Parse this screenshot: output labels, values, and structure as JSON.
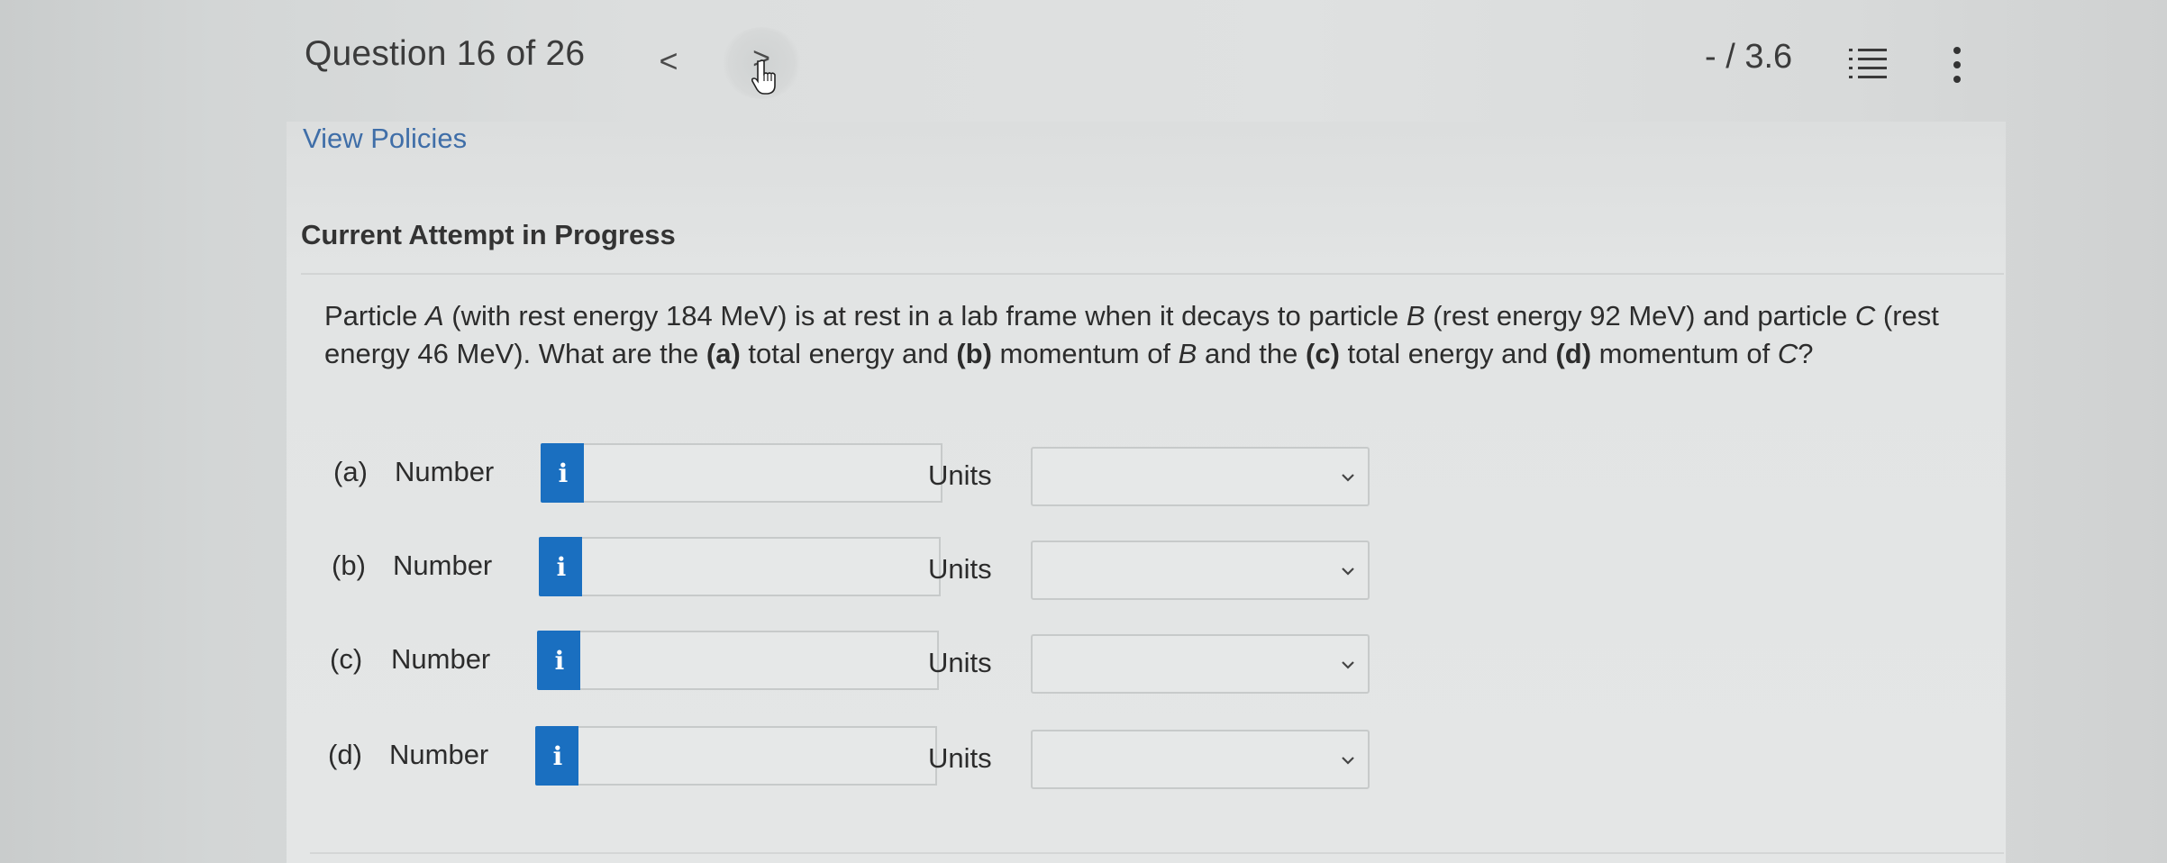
{
  "header": {
    "question_counter": "Question 16 of 26",
    "prev_glyph": "<",
    "next_glyph": ">",
    "score": "- / 3.6"
  },
  "view_policies": "View Policies",
  "attempt_status": "Current Attempt in Progress",
  "question": {
    "segments": [
      {
        "t": "Particle "
      },
      {
        "t": "A",
        "i": true
      },
      {
        "t": " (with rest energy  184 MeV) is at rest in a lab frame when it decays to particle "
      },
      {
        "t": "B",
        "i": true
      },
      {
        "t": " (rest energy  92 MeV) and particle "
      },
      {
        "t": "C",
        "i": true
      },
      {
        "t": " (rest energy  46 MeV). What are the "
      },
      {
        "t": "(a)",
        "b": true
      },
      {
        "t": " total energy and "
      },
      {
        "t": "(b)",
        "b": true
      },
      {
        "t": " momentum of  "
      },
      {
        "t": "B",
        "i": true
      },
      {
        "t": " and the "
      },
      {
        "t": "(c)",
        "b": true
      },
      {
        "t": " total energy and "
      },
      {
        "t": "(d)",
        "b": true
      },
      {
        "t": " momentum of "
      },
      {
        "t": "C",
        "i": true
      },
      {
        "t": "?"
      }
    ]
  },
  "answer_rows": [
    {
      "part": "(a)",
      "number_label": "Number",
      "info": "i",
      "value": "",
      "units_label": "Units",
      "units_value": ""
    },
    {
      "part": "(b)",
      "number_label": "Number",
      "info": "i",
      "value": "",
      "units_label": "Units",
      "units_value": ""
    },
    {
      "part": "(c)",
      "number_label": "Number",
      "info": "i",
      "value": "",
      "units_label": "Units",
      "units_value": ""
    },
    {
      "part": "(d)",
      "number_label": "Number",
      "info": "i",
      "value": "",
      "units_label": "Units",
      "units_value": ""
    }
  ],
  "colors": {
    "info_button": "#1a6fc0",
    "link": "#3f6ea8"
  },
  "icons": [
    "chevron-left-icon",
    "chevron-right-icon",
    "hand-cursor-icon",
    "list-icon",
    "kebab-menu-icon",
    "info-icon",
    "chevron-down-icon"
  ]
}
